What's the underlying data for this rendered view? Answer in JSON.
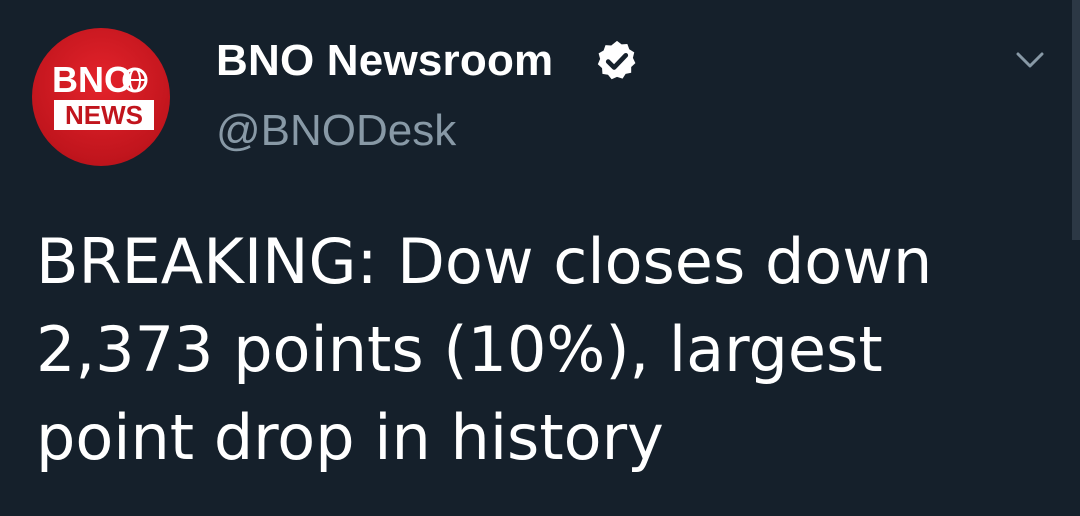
{
  "author": {
    "display_name": "BNO Newsroom",
    "handle": "@BNODesk",
    "verified": true,
    "avatar": {
      "logo_line1": "BNO",
      "logo_line2": "NEWS",
      "color": "#d71920"
    }
  },
  "tweet": {
    "lines": [
      "BREAKING: Dow closes down",
      "2,373 points (10%), largest",
      "point drop in history"
    ]
  },
  "icons": {
    "verified": "verified-badge-icon",
    "menu": "chevron-down-icon"
  },
  "colors": {
    "background": "#15202b",
    "secondary_text": "#8899a6",
    "primary_text": "#ffffff"
  }
}
